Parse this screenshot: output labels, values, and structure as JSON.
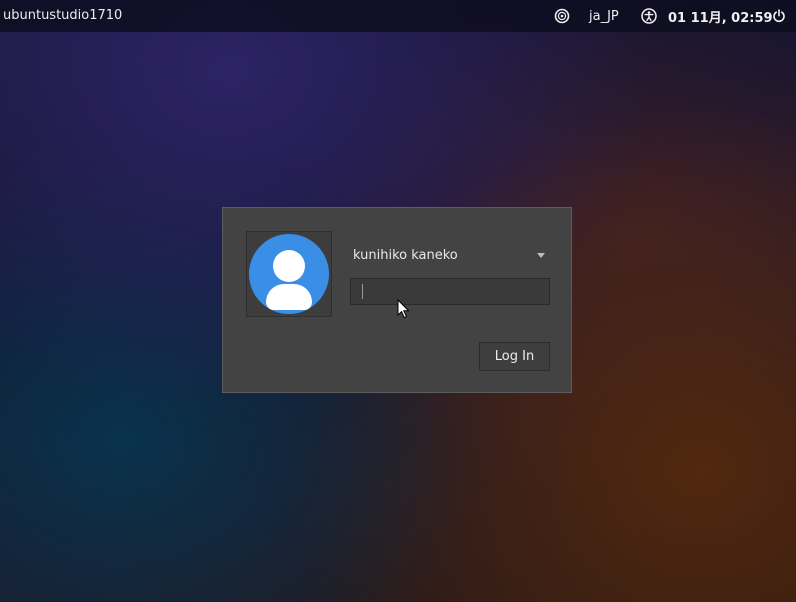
{
  "panel": {
    "hostname": "ubuntustudio1710",
    "session_icon": "session-disc-icon",
    "language": "ja_JP",
    "accessibility_icon": "accessibility-icon",
    "clock": "01 11月, 02:59",
    "power_icon": "power-icon"
  },
  "login": {
    "avatar_icon": "user-avatar-icon",
    "username": "kunihiko kaneko",
    "user_dropdown_icon": "chevron-down-icon",
    "password_value": "",
    "password_placeholder": "",
    "login_button": "Log In"
  },
  "colors": {
    "dialog_bg": "#434343",
    "avatar_blue": "#3a8ee6"
  }
}
